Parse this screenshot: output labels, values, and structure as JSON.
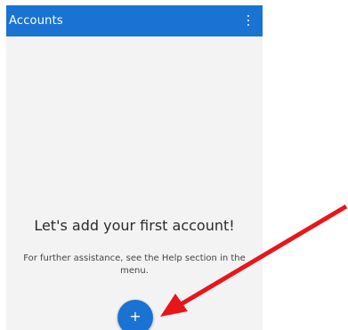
{
  "app_bar": {
    "title": "Accounts",
    "menu_icon": "more-vert-icon",
    "color": "#1a73d2"
  },
  "empty_state": {
    "headline": "Let's add your first account!",
    "help_text": "For further assistance, see the Help section in the menu."
  },
  "fab": {
    "icon": "plus-icon",
    "glyph": "+",
    "color": "#1a73d2"
  },
  "annotation": {
    "type": "arrow",
    "color": "#e8161b"
  }
}
